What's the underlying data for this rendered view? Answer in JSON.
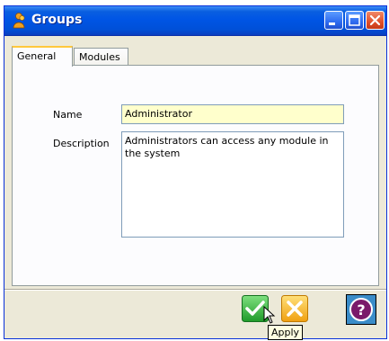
{
  "window": {
    "title": "Groups"
  },
  "tabs": [
    {
      "label": "General",
      "active": true
    },
    {
      "label": "Modules",
      "active": false
    }
  ],
  "form": {
    "name_label": "Name",
    "name_value": "Administrator",
    "description_label": "Description",
    "description_value": "Administrators can access any module in the system"
  },
  "footer": {
    "apply_tooltip": "Apply",
    "apply_icon": "check-icon",
    "cancel_icon": "x-icon",
    "help_icon": "question-icon"
  },
  "colors": {
    "titlebar": "#0055e5",
    "name_field_bg": "#ffffcc",
    "apply_green": "#3cb83c",
    "cancel_orange": "#f5b020",
    "help_blue": "#3a8cc8",
    "tab_highlight": "#ffc83c"
  }
}
